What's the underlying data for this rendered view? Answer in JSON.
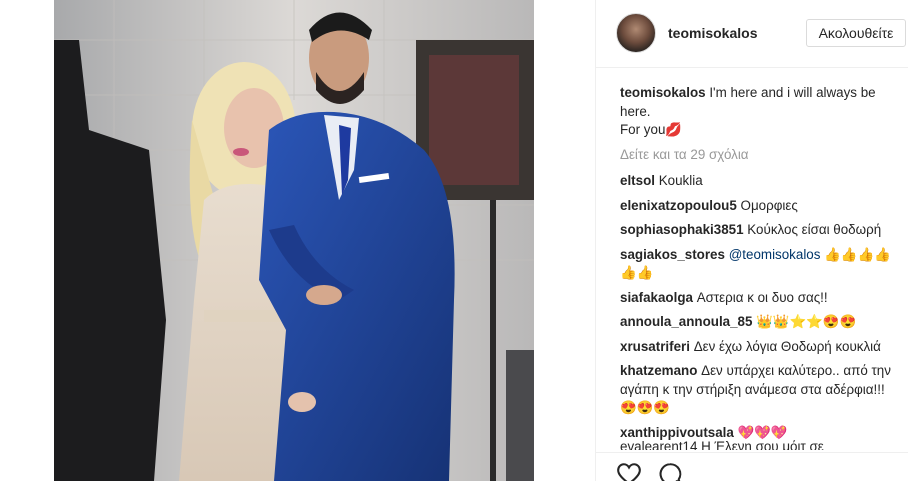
{
  "post": {
    "username": "teomisokalos",
    "follow_label": "Ακολουθείτε",
    "caption_line1": "I'm here and i will always be",
    "caption_line2": "here.",
    "caption_line3": "For you💋",
    "view_more_comments": "Δείτε και τα 29 σχόλια"
  },
  "comments": [
    {
      "user": "eltsol",
      "text": "Kouklia"
    },
    {
      "user": "elenixatzopoulou5",
      "text": "Ομορφιες"
    },
    {
      "user": "sophiasophaki3851",
      "text": "Κούκλος είσαι θοδωρή"
    },
    {
      "user": "sagiakos_stores",
      "mention": "@teomisokalos",
      "text": "👍👍👍👍👍👍"
    },
    {
      "user": "siafakaolga",
      "text": "Αστερια κ οι δυο σας!!"
    },
    {
      "user": "annoula_annoula_85",
      "text": "👑👑⭐⭐😍😍"
    },
    {
      "user": "xrusatriferi",
      "text": "Δεν έχω λόγια Θοδωρή κουκλιά"
    },
    {
      "user": "khatzemano",
      "text": "Δεν υπάρχει καλύτερο.. από την αγάπη κ την στήριξη ανάμεσα στα αδέρφια!!! 😍😍😍"
    },
    {
      "user": "xanthippivoutsala",
      "text": "💖💖💖"
    }
  ],
  "clipped_comment": "evalearent14 Η Έλενη σου μόιτ σε",
  "icons": {
    "like": "heart-icon",
    "comment": "comment-bubble-icon"
  },
  "colors": {
    "link": "#003569",
    "muted": "#999999",
    "border": "#efefef",
    "suit": "#1f3f8e"
  }
}
